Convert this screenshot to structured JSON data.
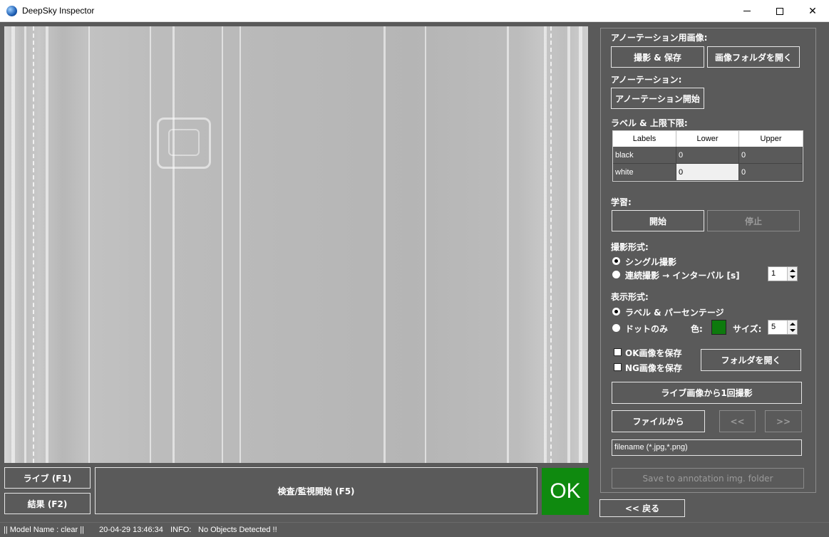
{
  "window": {
    "title": "DeepSky Inspector"
  },
  "viewer": {
    "image_label": ""
  },
  "left_buttons": {
    "live": "ライブ (F1)",
    "result": "結果 (F2)",
    "start_inspect": "検査/監視開始 (F5)"
  },
  "judgement": {
    "text": "OK",
    "color": "#0f8a0f"
  },
  "annotation_images": {
    "section_label": "アノーテーション用画像:",
    "capture_save": "撮影 & 保存",
    "open_image_folder": "画像フォルダを開く"
  },
  "annotation": {
    "section_label": "アノーテーション:",
    "start": "アノーテーション開始"
  },
  "labels_limits": {
    "section_label": "ラベル & 上限下限:",
    "columns": [
      "Labels",
      "Lower",
      "Upper"
    ],
    "rows": [
      {
        "label": "black",
        "lower": "0",
        "upper": "0"
      },
      {
        "label": "white",
        "lower": "0",
        "upper": "0"
      }
    ]
  },
  "learning": {
    "section_label": "学習:",
    "start": "開始",
    "stop": "停止"
  },
  "capture_mode": {
    "section_label": "撮影形式:",
    "single": "シングル撮影",
    "continuous": "連続撮影 → インターバル [s]",
    "interval_value": "1"
  },
  "display_mode": {
    "section_label": "表示形式:",
    "label_percent": "ラベル & パーセンテージ",
    "dots_only": "ドットのみ",
    "color_label": "色:",
    "color_value": "#0d7a0d",
    "size_label": "サイズ:",
    "size_value": "5"
  },
  "save_options": {
    "save_ok": "OK画像を保存",
    "save_ng": "NG画像を保存",
    "open_folder": "フォルダを開く"
  },
  "capture_once": "ライブ画像から1回撮影",
  "file_nav": {
    "from_file": "ファイルから",
    "prev": "<<",
    "next": ">>"
  },
  "filename_field": {
    "value": "filename (*.jpg,*.png)"
  },
  "save_to_annotation": "Save to annotation img. folder",
  "back_button": "<< 戻る",
  "status": {
    "model": "|| Model Name : clear ||",
    "timestamp": "20-04-29 13:46:34",
    "level": "INFO:",
    "message": "No Objects Detected !!"
  }
}
